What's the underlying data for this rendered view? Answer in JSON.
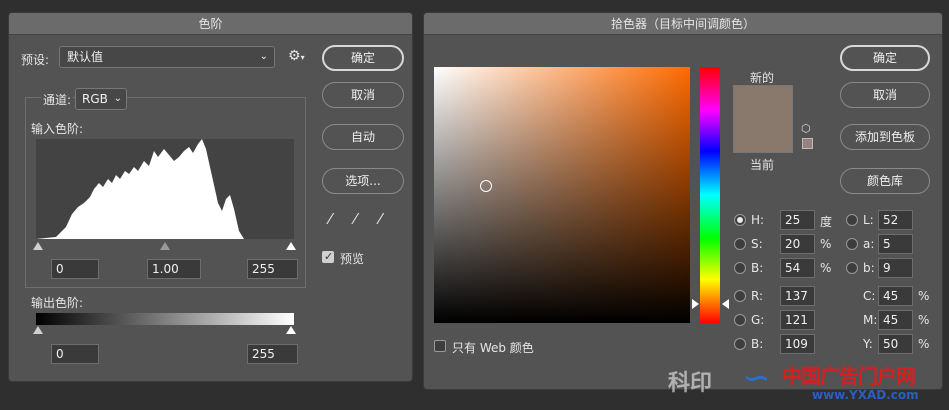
{
  "levels": {
    "title": "色阶",
    "preset_label": "预设:",
    "preset_value": "默认值",
    "channel_label": "通道:",
    "channel_value": "RGB",
    "input_label": "输入色阶:",
    "input_black": "0",
    "input_gamma": "1.00",
    "input_white": "255",
    "output_label": "输出色阶:",
    "output_black": "0",
    "output_white": "255",
    "ok": "确定",
    "cancel": "取消",
    "auto": "自动",
    "options": "选项...",
    "preview": "预览",
    "preview_checked": true
  },
  "picker": {
    "title": "拾色器（目标中间调颜色）",
    "ok": "确定",
    "cancel": "取消",
    "add_swatch": "添加到色板",
    "libraries": "颜色库",
    "new_label": "新的",
    "current_label": "当前",
    "new_color": "#89796d",
    "current_color": "#89796d",
    "web_only": "只有 Web 颜色",
    "H_label": "H:",
    "H_val": "25",
    "H_unit": "度",
    "S_label": "S:",
    "S_val": "20",
    "S_unit": "%",
    "Bv_label": "B:",
    "Bv_val": "54",
    "Bv_unit": "%",
    "R_label": "R:",
    "R_val": "137",
    "G_label": "G:",
    "G_val": "121",
    "Bc_label": "B:",
    "Bc_val": "109",
    "L_label": "L:",
    "L_val": "52",
    "a_label": "a:",
    "a_val": "5",
    "b_label": "b:",
    "b_val": "9",
    "C_label": "C:",
    "C_val": "45",
    "C_unit": "%",
    "M_label": "M:",
    "M_val": "45",
    "M_unit": "%",
    "Y_label": "Y:",
    "Y_val": "50",
    "Y_unit": "%",
    "hue_color": "#ff6a00"
  },
  "watermark": {
    "left_text": "科印",
    "site_name": "中国广告门户网",
    "site_url": "www.YXAD.com"
  }
}
